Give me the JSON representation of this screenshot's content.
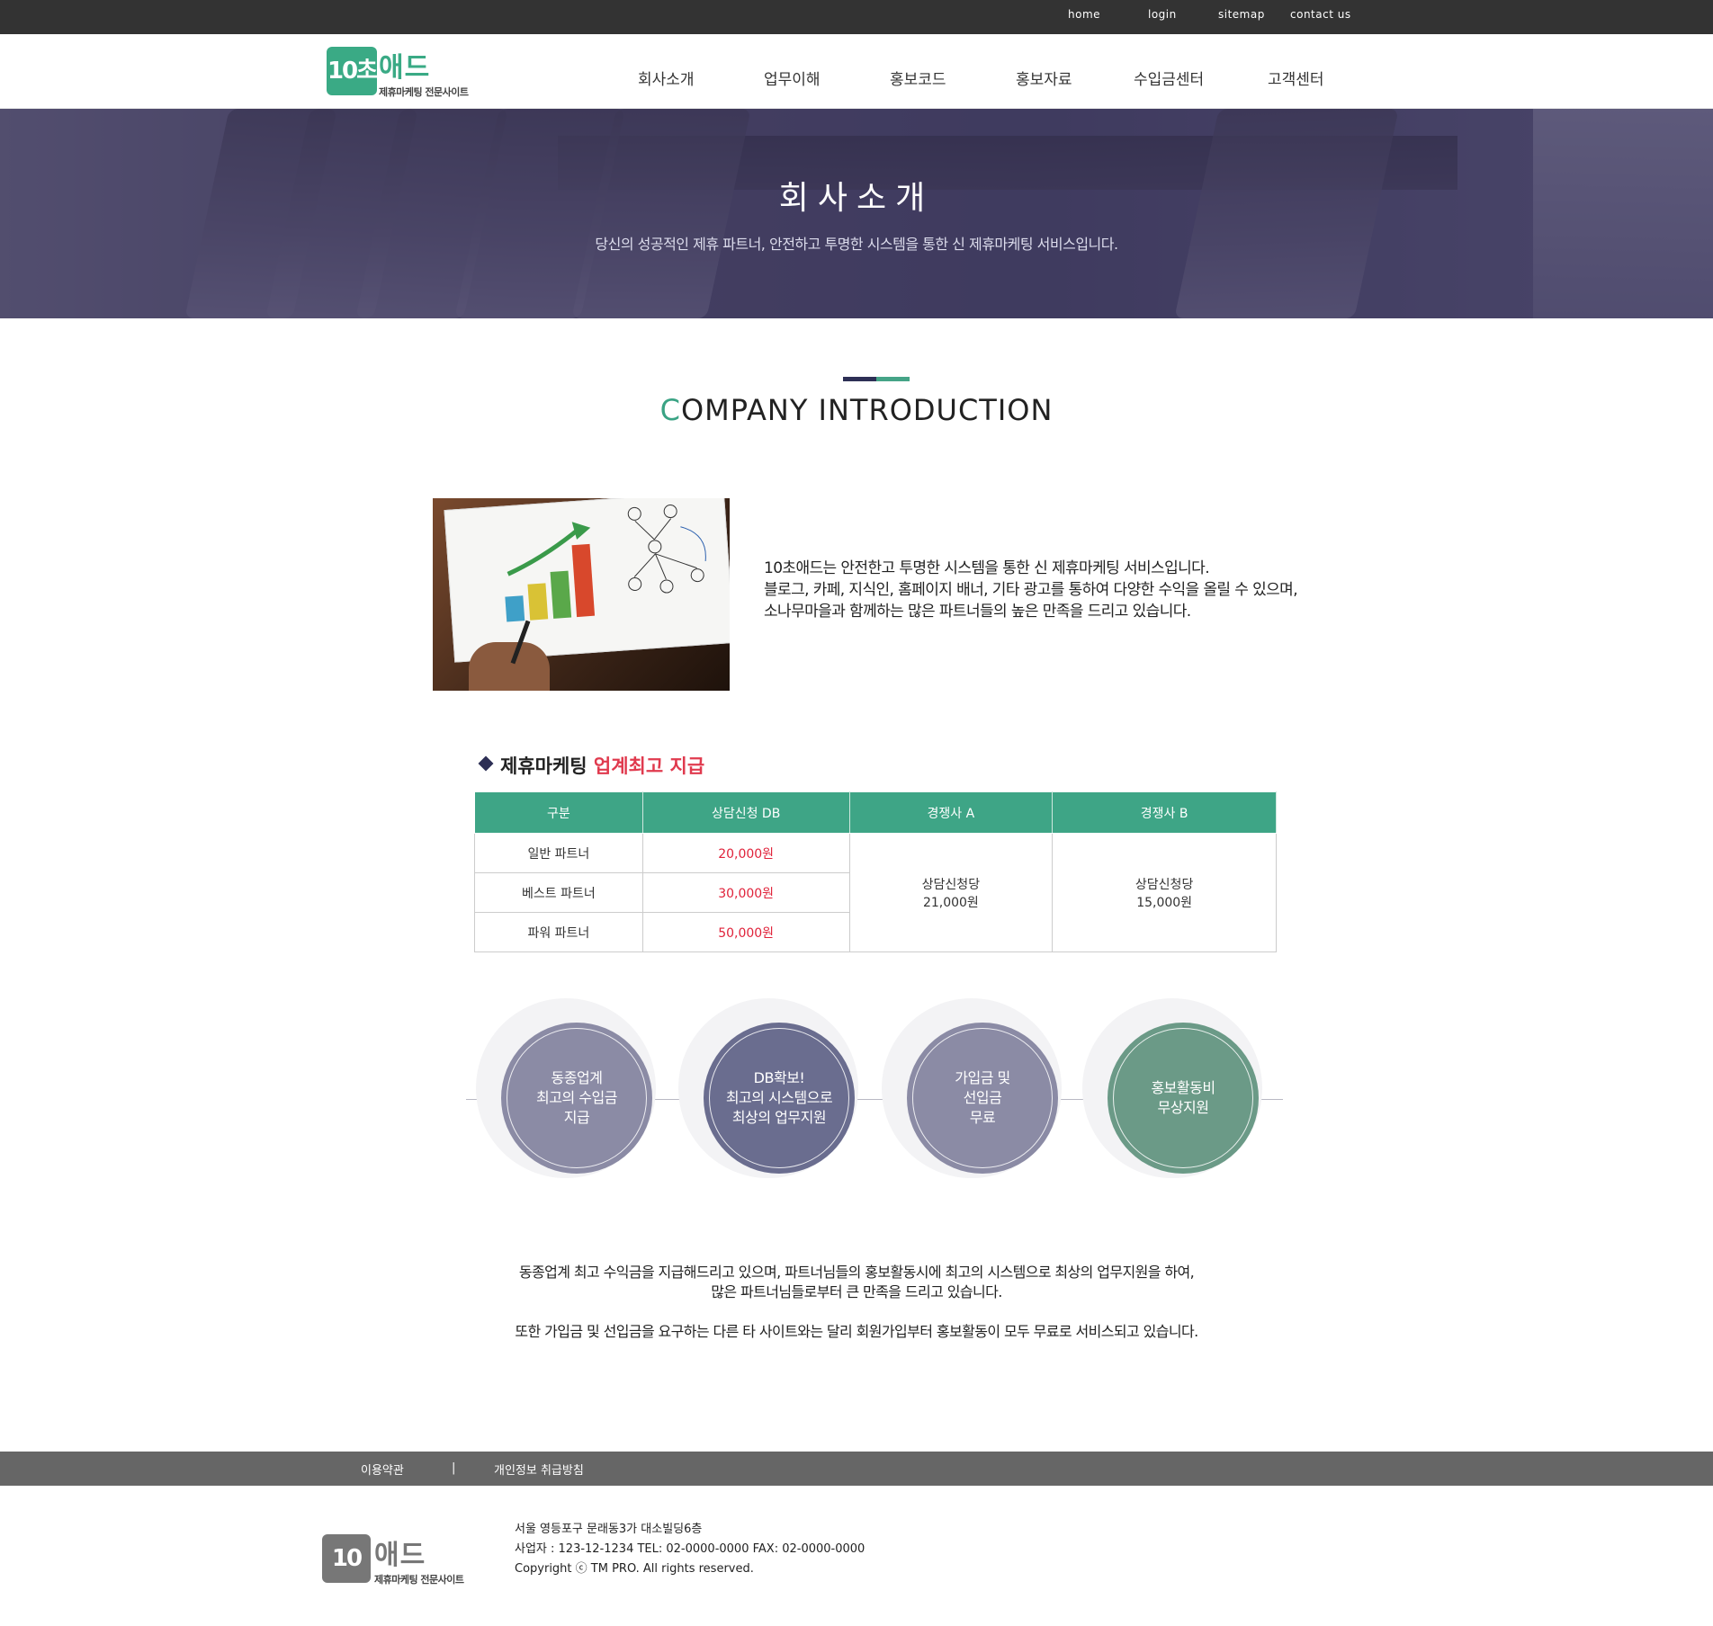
{
  "topbar": {
    "links": [
      "home",
      "login",
      "sitemap",
      "contact us"
    ]
  },
  "logo": {
    "number": "10초",
    "word": "애드",
    "tagline": "제휴마케팅 전문사이트"
  },
  "nav": {
    "items": [
      "회사소개",
      "업무이해",
      "홍보코드",
      "홍보자료",
      "수입금센터",
      "고객센터"
    ]
  },
  "hero": {
    "title": "회사소개",
    "subtitle": "당신의 성공적인 제휴 파트너, 안전하고 투명한 시스템을 통한 신 제휴마케팅 서비스입니다."
  },
  "section": {
    "title_first": "C",
    "title_rest": "OMPANY INTRODUCTION"
  },
  "intro": {
    "lines": [
      "10초애드는 안전한고 투명한 시스템을 통한 신 제휴마케팅 서비스입니다.",
      "블로그, 카페, 지식인, 홈페이지 배너, 기타 광고를 통하여 다양한 수익을 올릴 수 있으며,",
      "소나무마을과 함께하는 많은 파트너들의 높은 만족을 드리고 있습니다."
    ]
  },
  "pricing": {
    "title_a": "제휴마케팅 ",
    "title_b": "업계최고 지급",
    "headers": [
      "구분",
      "상담신청 DB",
      "경쟁사 A",
      "경쟁사 B"
    ],
    "rows": [
      {
        "label": "일반 파트너",
        "price": "20,000원"
      },
      {
        "label": "베스트 파트너",
        "price": "30,000원"
      },
      {
        "label": "파워 파트너",
        "price": "50,000원"
      }
    ],
    "competitor_a": {
      "line1": "상담신청당",
      "line2": "21,000원"
    },
    "competitor_b": {
      "line1": "상담신청당",
      "line2": "15,000원"
    }
  },
  "features": [
    {
      "line1": "동종업계",
      "line2": "최고의 수입금",
      "line3": "지급",
      "color": "#8b8ba5"
    },
    {
      "line1": "DB확보!",
      "line2": "최고의 시스템으로",
      "line3": "최상의 업무지원",
      "color": "#6a6d8f"
    },
    {
      "line1": "가입금 및",
      "line2": "선입금",
      "line3": "무료",
      "color": "#8b8ba5"
    },
    {
      "line1": "홍보활동비",
      "line2": "무상지원",
      "line3": "",
      "color": "#6b9a87"
    }
  ],
  "description": {
    "line1": "동종업계 최고 수익금을 지급해드리고 있으며, 파트너님들의 홍보활동시에 최고의 시스템으로 최상의 업무지원을 하여,",
    "line2": "많은 파트너님들로부터 큰 만족을 드리고 있습니다.",
    "line3": "또한 가입금 및 선입금을 요구하는 다른 타 사이트와는 달리 회원가입부터 홍보활동이 모두 무료로 서비스되고 있습니다."
  },
  "footer": {
    "links": [
      "이용약관",
      "개인정보 취급방침"
    ],
    "separator": "|",
    "address": "서울 영등포구 문래동3가 대소빌딩6층",
    "business": "사업자 : 123-12-1234 TEL: 02-0000-0000 FAX: 02-0000-0000",
    "copyright": "Copyright ⓒ TM PRO. All rights reserved."
  }
}
